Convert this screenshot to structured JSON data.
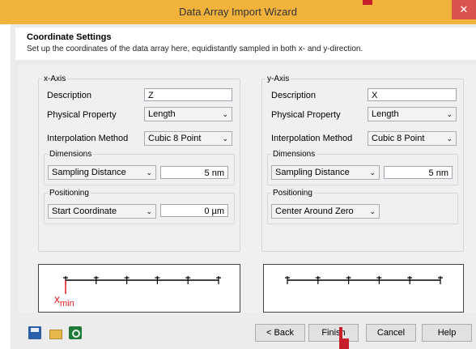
{
  "window": {
    "title": "Data Array Import Wizard",
    "close_icon": "close-icon"
  },
  "header": {
    "title": "Coordinate Settings",
    "subtitle": "Set up the coordinates of the data array here, equidistantly sampled in both x- and y-direction."
  },
  "x_axis": {
    "legend": "x-Axis",
    "description_label": "Description",
    "description_value": "Z",
    "physical_property_label": "Physical Property",
    "physical_property_value": "Length",
    "interpolation_label": "Interpolation Method",
    "interpolation_value": "Cubic 8 Point",
    "dimensions_legend": "Dimensions",
    "dimensions_mode": "Sampling Distance",
    "dimensions_value": "5 nm",
    "positioning_legend": "Positioning",
    "positioning_mode": "Start Coordinate",
    "positioning_value": "0 µm",
    "preview_marker_label": "x",
    "preview_marker_sub": "min"
  },
  "y_axis": {
    "legend": "y-Axis",
    "description_label": "Description",
    "description_value": "X",
    "physical_property_label": "Physical Property",
    "physical_property_value": "Length",
    "interpolation_label": "Interpolation Method",
    "interpolation_value": "Cubic 8 Point",
    "dimensions_legend": "Dimensions",
    "dimensions_mode": "Sampling Distance",
    "dimensions_value": "5 nm",
    "positioning_legend": "Positioning",
    "positioning_mode": "Center Around Zero"
  },
  "footer": {
    "back": "< Back",
    "finish": "Finish",
    "cancel": "Cancel",
    "help": "Help",
    "tools": [
      "save-icon",
      "open-folder-icon",
      "refresh-icon"
    ]
  },
  "colors": {
    "title_bar": "#f2b33d",
    "close": "#d9534f",
    "marker": "#e81c24",
    "cursor": "#c8202a"
  }
}
